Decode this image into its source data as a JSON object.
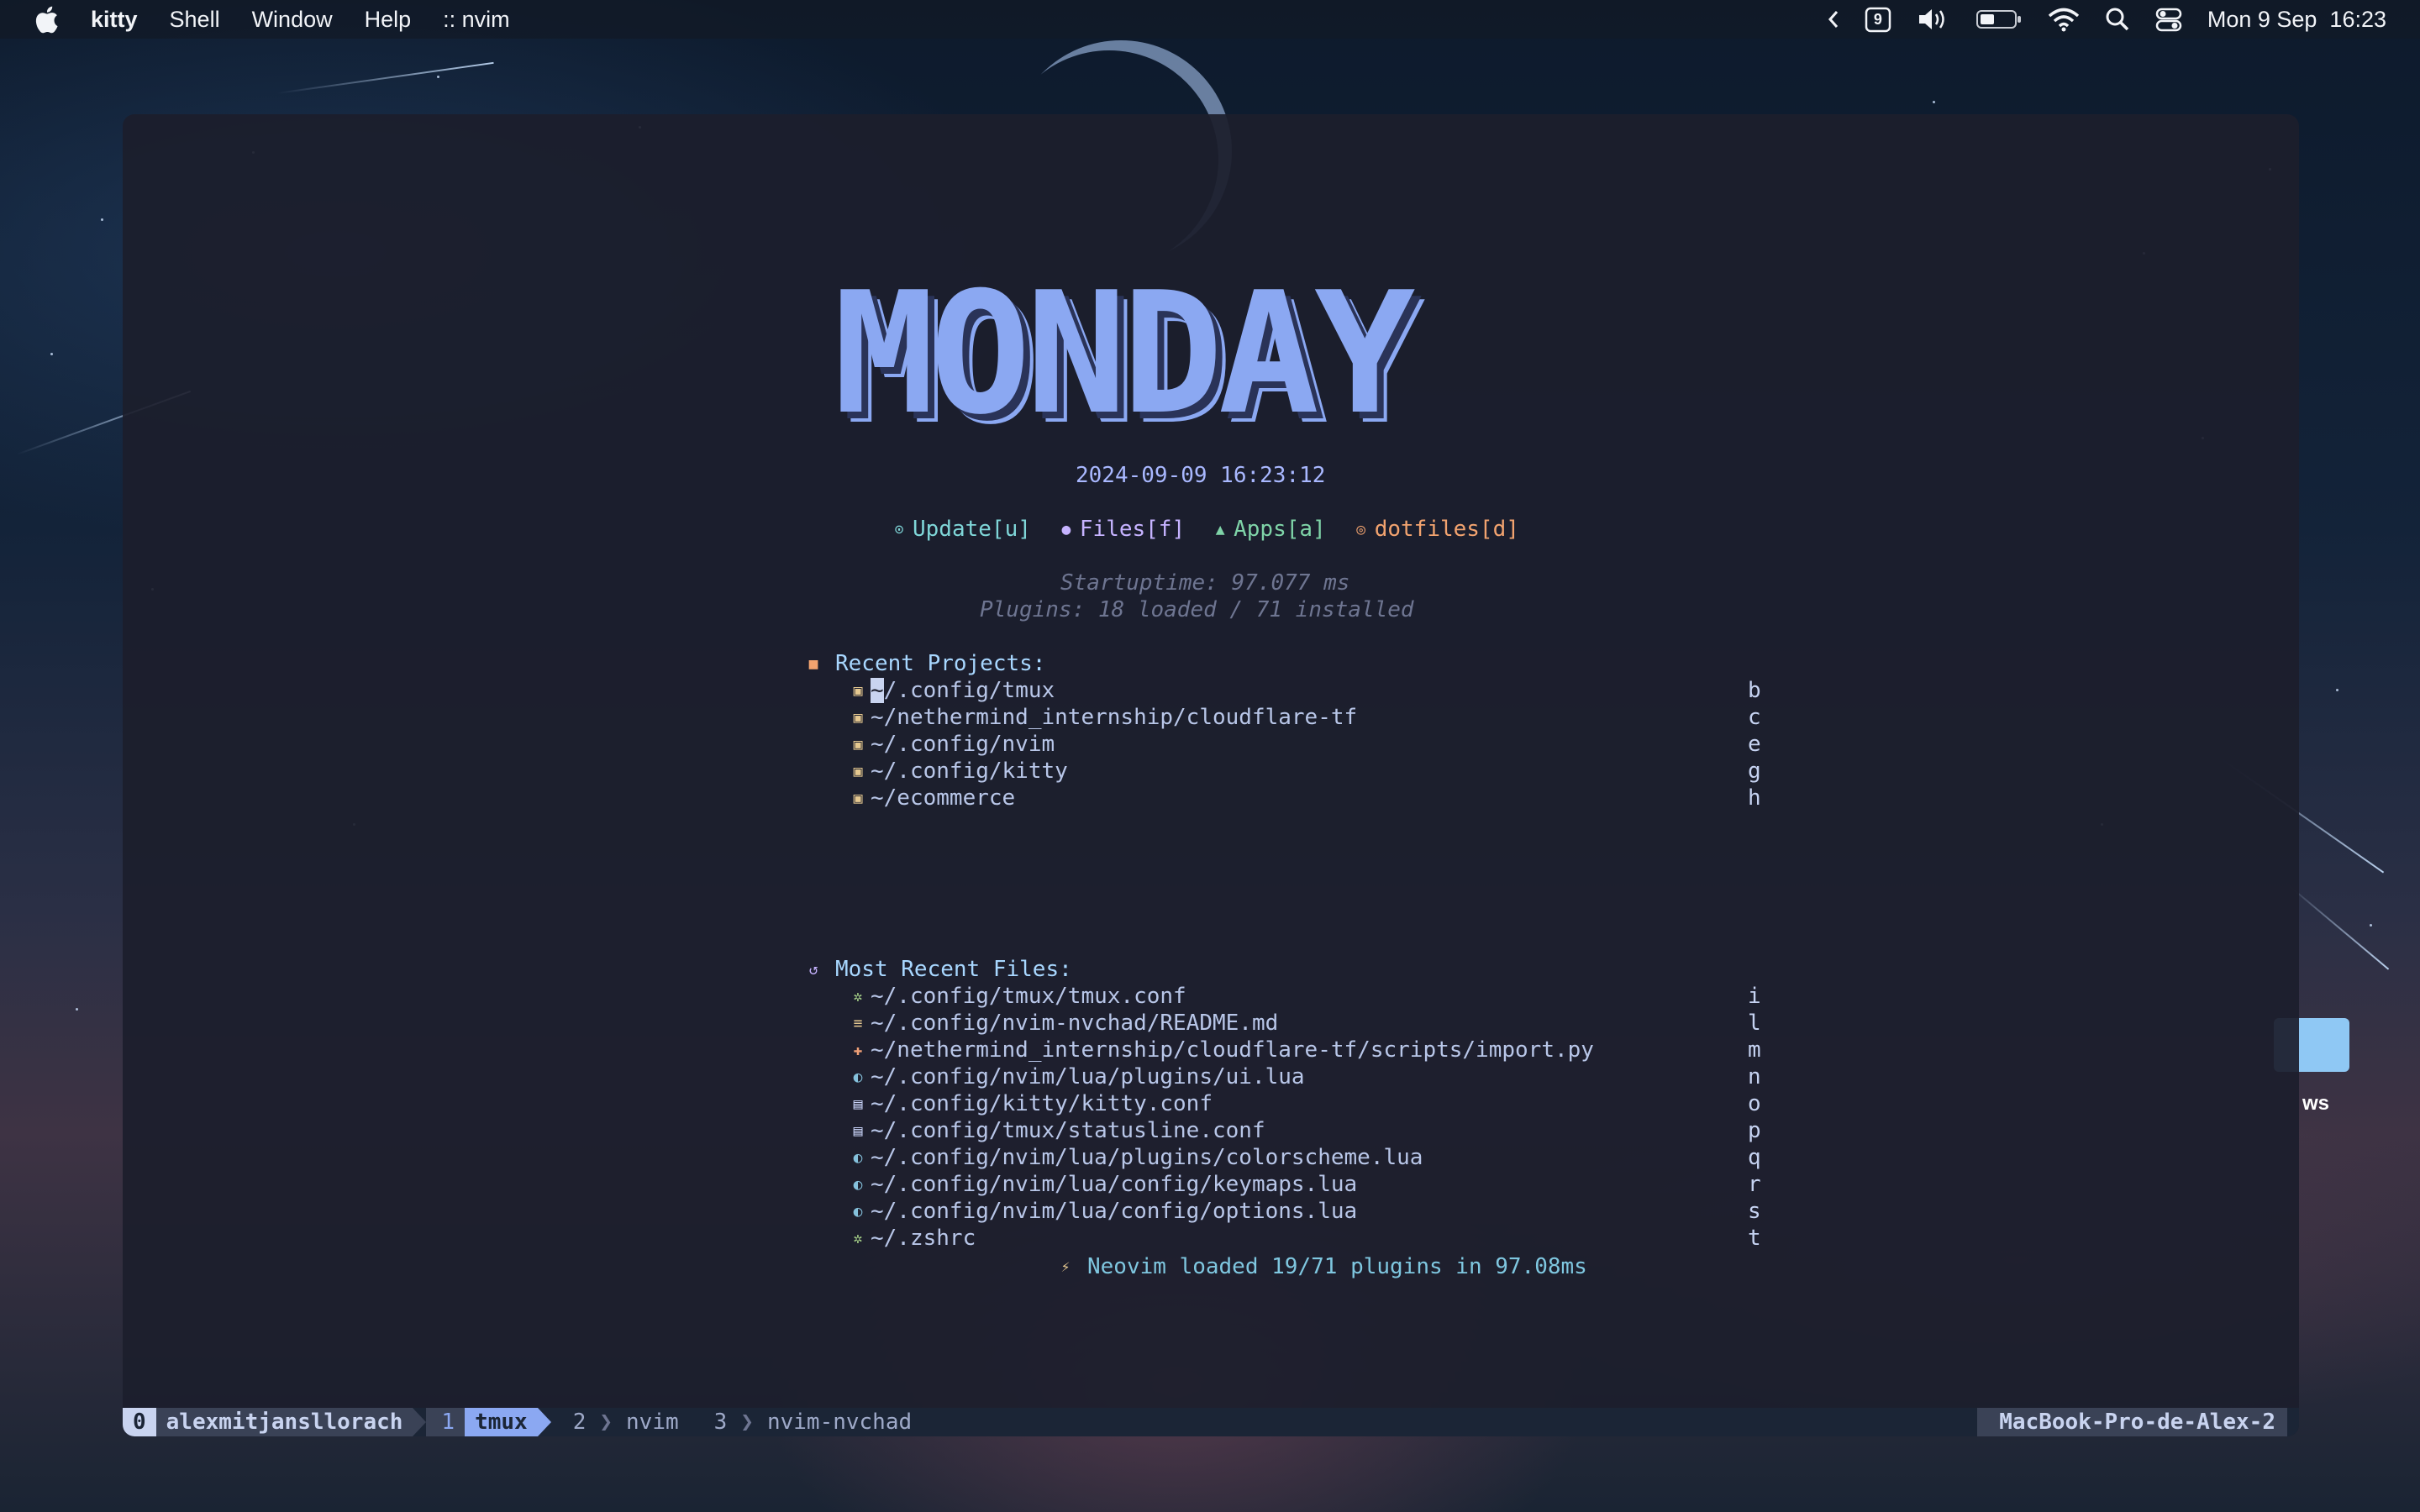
{
  "menubar": {
    "app_name": "kitty",
    "items": [
      "Shell",
      "Window",
      "Help",
      ":: nvim"
    ],
    "status_icons": [
      "chevron-left-icon",
      "calendar-9-icon",
      "volume-icon",
      "battery-icon",
      "wifi-icon",
      "search-icon",
      "control-center-icon"
    ],
    "calendar_badge": "9",
    "datetime": "Mon 9 Sep  16:23"
  },
  "dashboard": {
    "banner": "MONDAY",
    "datetime": "2024-09-09 16:23:12",
    "actions": [
      {
        "icon": "update-icon",
        "label": "Update[u]"
      },
      {
        "icon": "files-icon",
        "label": "Files[f]"
      },
      {
        "icon": "home-icon",
        "label": "Apps[a]"
      },
      {
        "icon": "dotfiles-icon",
        "label": "dotfiles[d]"
      }
    ],
    "startuptime": "Startuptime: 97.077 ms",
    "plugins": "Plugins: 18 loaded / 71 installed",
    "recent_projects": {
      "heading": "Recent Projects:",
      "items": [
        {
          "path": "~/.config/tmux",
          "key": "b"
        },
        {
          "path": "~/nethermind_internship/cloudflare-tf",
          "key": "c"
        },
        {
          "path": "~/.config/nvim",
          "key": "e"
        },
        {
          "path": "~/.config/kitty",
          "key": "g"
        },
        {
          "path": "~/ecommerce",
          "key": "h"
        }
      ]
    },
    "recent_files": {
      "heading": "Most Recent Files:",
      "items": [
        {
          "icon": "gear-icon",
          "path": "~/.config/tmux/tmux.conf",
          "key": "i",
          "color": "#a6d189"
        },
        {
          "icon": "markdown-icon",
          "path": "~/.config/nvim-nvchad/README.md",
          "key": "l",
          "color": "#e5c890"
        },
        {
          "icon": "python-icon",
          "path": "~/nethermind_internship/cloudflare-tf/scripts/import.py",
          "key": "m",
          "color": "#ef9f76"
        },
        {
          "icon": "lua-icon",
          "path": "~/.config/nvim/lua/plugins/ui.lua",
          "key": "n",
          "color": "#85c1dc"
        },
        {
          "icon": "file-icon",
          "path": "~/.config/kitty/kitty.conf",
          "key": "o",
          "color": "#c6d0f5"
        },
        {
          "icon": "file-icon",
          "path": "~/.config/tmux/statusline.conf",
          "key": "p",
          "color": "#c6d0f5"
        },
        {
          "icon": "lua-icon",
          "path": "~/.config/nvim/lua/plugins/colorscheme.lua",
          "key": "q",
          "color": "#85c1dc"
        },
        {
          "icon": "lua-icon",
          "path": "~/.config/nvim/lua/config/keymaps.lua",
          "key": "r",
          "color": "#85c1dc"
        },
        {
          "icon": "lua-icon",
          "path": "~/.config/nvim/lua/config/options.lua",
          "key": "s",
          "color": "#85c1dc"
        },
        {
          "icon": "gear-icon",
          "path": "~/.zshrc",
          "key": "t",
          "color": "#a6d189"
        }
      ]
    },
    "footer": "Neovim loaded 19/71 plugins in 97.08ms"
  },
  "tmux": {
    "session_index": "0",
    "session_name": "alexmitjansllorach",
    "windows": [
      {
        "index": "1",
        "name": "tmux",
        "active": true
      },
      {
        "index": "2",
        "name": "nvim",
        "active": false
      },
      {
        "index": "3",
        "name": "nvim-nvchad",
        "active": false
      }
    ],
    "host": "MacBook-Pro-de-Alex-2"
  },
  "desktop": {
    "folder_label": "ws"
  },
  "colors": {
    "banner": "#8ba8f2",
    "accent": "#8ba8f2",
    "terminal_bg": "#1c1e2c"
  }
}
